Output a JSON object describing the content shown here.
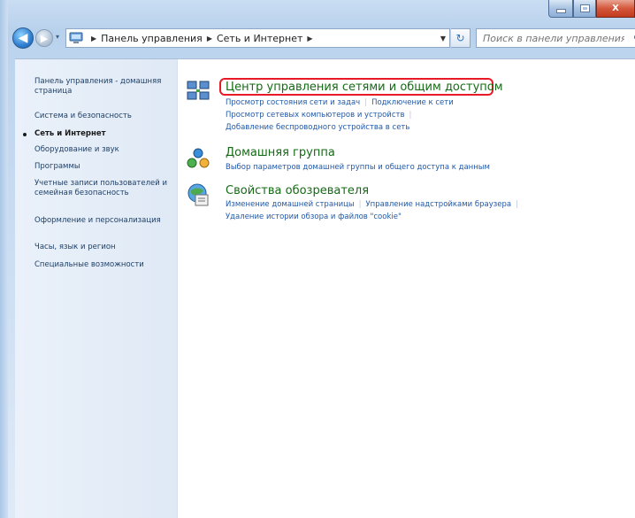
{
  "window": {
    "minimize": "",
    "close_label": "X"
  },
  "nav": {
    "breadcrumb": [
      "Панель управления",
      "Сеть и Интернет"
    ],
    "search_placeholder": "Поиск в панели управления"
  },
  "sidebar": {
    "items": [
      {
        "label": "Панель управления - домашняя страница"
      },
      {
        "label": "Система и безопасность"
      },
      {
        "label": "Сеть и Интернет",
        "current": true
      },
      {
        "label": "Оборудование и звук"
      },
      {
        "label": "Программы"
      },
      {
        "label": "Учетные записи пользователей и семейная безопасность"
      },
      {
        "label": "Оформление и персонализация"
      },
      {
        "label": "Часы, язык и регион"
      },
      {
        "label": "Специальные возможности"
      }
    ]
  },
  "categories": [
    {
      "title": "Центр управления сетями и общим доступом",
      "links": [
        [
          "Просмотр состояния сети и задач",
          "Подключение к сети"
        ],
        [
          "Просмотр сетевых компьютеров и устройств"
        ],
        [
          "Добавление беспроводного устройства в сеть"
        ]
      ],
      "icon": "network-center-icon"
    },
    {
      "title": "Домашняя группа",
      "links": [
        [
          "Выбор параметров домашней группы и общего доступа к данным"
        ]
      ],
      "icon": "homegroup-icon"
    },
    {
      "title": "Свойства обозревателя",
      "links": [
        [
          "Изменение домашней страницы",
          "Управление надстройками браузера"
        ],
        [
          "Удаление истории обзора и файлов \"cookie\""
        ]
      ],
      "icon": "internet-options-icon"
    }
  ],
  "colors": {
    "title_green": "#156a15",
    "link_blue": "#2058a8",
    "highlight_red": "#e81a27"
  }
}
